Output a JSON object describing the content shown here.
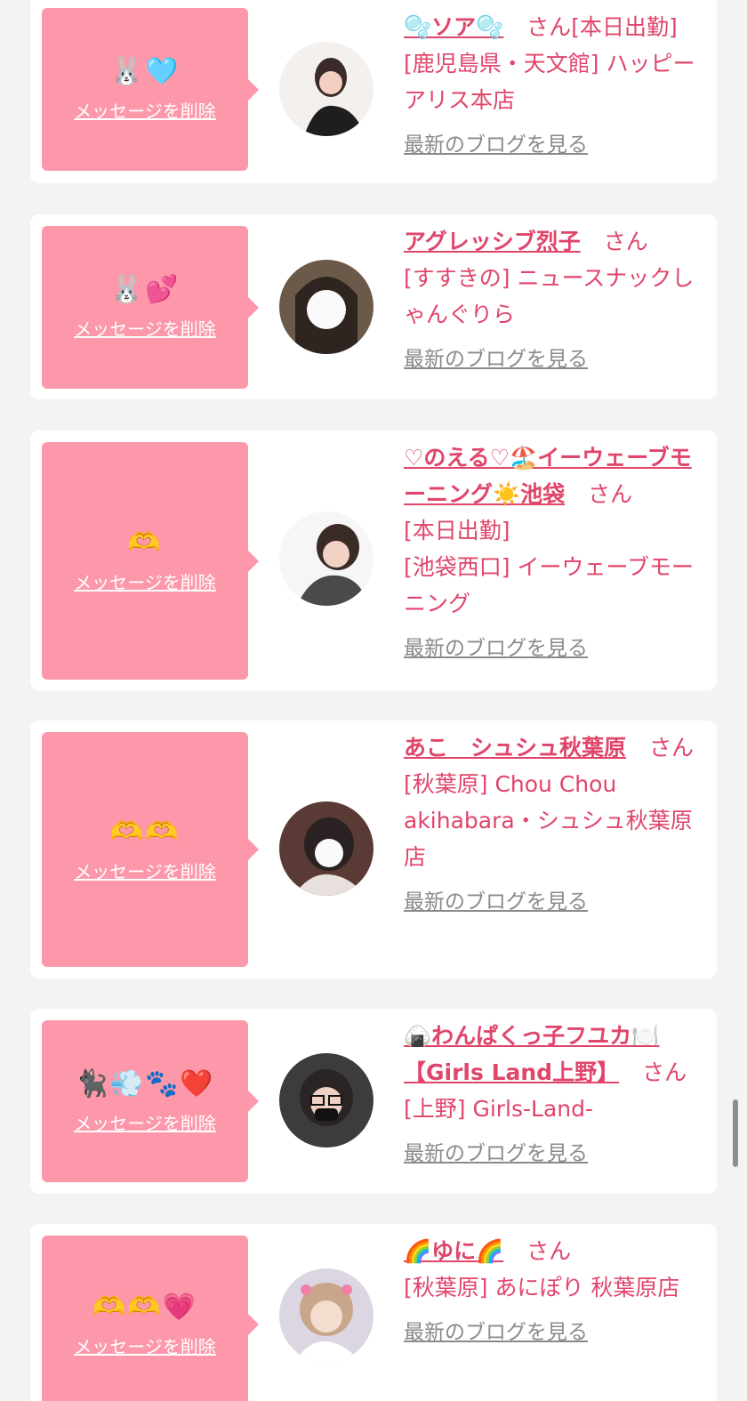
{
  "common": {
    "delete_label": "メッセージを削除",
    "blog_label": "最新のブログを見る",
    "san_label": "さん"
  },
  "cards": [
    {
      "emoji": "🐰🩵",
      "name": "🫧ソア🫧",
      "status": "[本日出勤]",
      "shop": "[鹿児島県・天文館] ハッピーアリス本店"
    },
    {
      "emoji": "🐰💕",
      "name": "アグレッシブ烈子",
      "status": "",
      "shop": "[すすきの] ニュースナックしゃんぐりら"
    },
    {
      "emoji": "🫶",
      "name": "♡のえる♡🏖️イーウェーブモーニング☀️池袋",
      "status": "[本日出勤]",
      "shop": "[池袋西口] イーウェーブモーニング"
    },
    {
      "emoji": "🫶🫶",
      "name": "あこ　シュシュ秋葉原",
      "status": "",
      "shop": "[秋葉原] Chou Chou akihabara・シュシュ秋葉原店"
    },
    {
      "emoji": "🐈‍⬛💨🐾❤️",
      "name": "🍙わんぱくっ子フユカ🍽️【Girls Land上野】",
      "status": "",
      "shop": "[上野] Girls-Land-"
    },
    {
      "emoji": "🫶🫶💗",
      "name": "🌈ゆに🌈",
      "status": "",
      "shop": "[秋葉原] あにぽり 秋葉原店"
    }
  ],
  "colors": {
    "accent": "#e0456a",
    "message_box": "#fd98ab",
    "link_gray": "#8a8a8a",
    "background": "#f3f3f3"
  }
}
